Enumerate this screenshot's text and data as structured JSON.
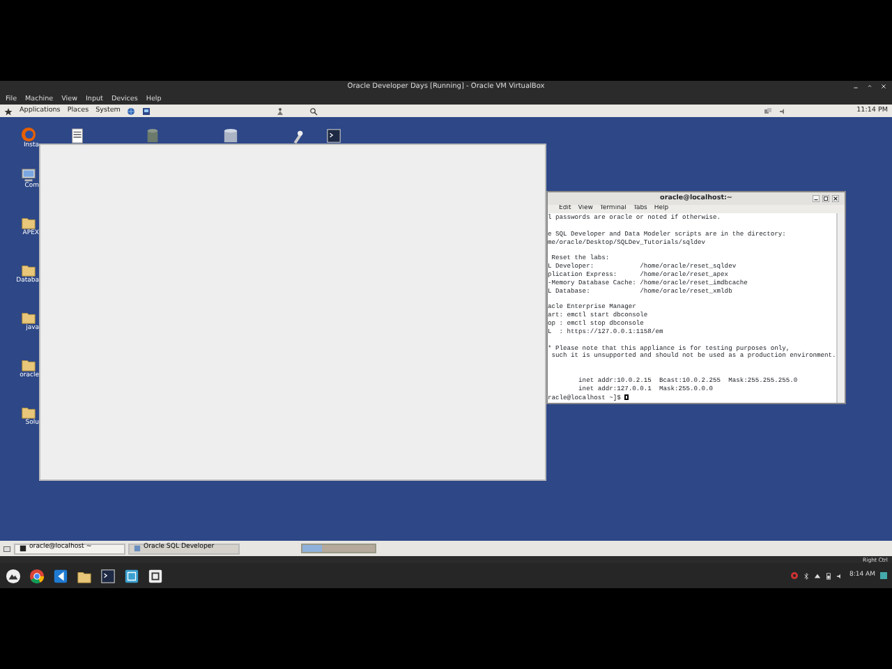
{
  "host_window": {
    "title": "Oracle Developer Days [Running] - Oracle VM VirtualBox"
  },
  "vbox_menu": [
    "File",
    "Machine",
    "View",
    "Input",
    "Devices",
    "Help"
  ],
  "guest_panel": {
    "menus": [
      "Applications",
      "Places",
      "System"
    ],
    "clock": "11:14 PM"
  },
  "desktop_top_icons": [
    {
      "kind": "document"
    },
    {
      "kind": "database-grey"
    },
    {
      "kind": "database-blue"
    },
    {
      "kind": "tool"
    },
    {
      "kind": "terminal"
    }
  ],
  "desktop_icons": [
    {
      "kind": "firefox",
      "label": "Insta"
    },
    {
      "kind": "computer",
      "label": "Com"
    },
    {
      "kind": "folder",
      "label": "APEX"
    },
    {
      "kind": "folder",
      "label": "Databa"
    },
    {
      "kind": "folder",
      "label": "java"
    },
    {
      "kind": "folder",
      "label": "oracle"
    },
    {
      "kind": "folder",
      "label": "Solu"
    }
  ],
  "terminal": {
    "title": "oracle@localhost:~",
    "menu": [
      "Edit",
      "View",
      "Terminal",
      "Tabs",
      "Help"
    ],
    "lines": [
      {
        "text": "l passwords are oracle or noted if otherwise."
      },
      {
        "kind": "blank"
      },
      {
        "text": "e SQL Developer and Data Modeler scripts are in the directory:"
      },
      {
        "text": "me/oracle/Desktop/SQLDev_Tutorials/sqldev"
      },
      {
        "kind": "blank"
      },
      {
        "text": " Reset the labs:"
      },
      {
        "text": "L Developer:            /home/oracle/reset_sqldev"
      },
      {
        "text": "plication Express:      /home/oracle/reset_apex"
      },
      {
        "text": "-Memory Database Cache: /home/oracle/reset_imdbcache"
      },
      {
        "text": "L Database:             /home/oracle/reset_xmldb"
      },
      {
        "kind": "blank"
      },
      {
        "text": "acle Enterprise Manager"
      },
      {
        "text": "art: emctl start dbconsole"
      },
      {
        "text": "op : emctl stop dbconsole"
      },
      {
        "text": "L  : https://127.0.0.1:1158/em"
      },
      {
        "kind": "blank"
      },
      {
        "text": "* Please note that this appliance is for testing purposes only,"
      },
      {
        "text": " such it is unsupported and should not be used as a production environment."
      },
      {
        "kind": "blank"
      },
      {
        "kind": "blank"
      },
      {
        "text": "        inet addr:10.0.2.15  Bcast:10.0.2.255  Mask:255.255.255.0"
      },
      {
        "text": "        inet addr:127.0.0.1  Mask:255.0.0.0"
      },
      {
        "text": "racle@localhost ~]$ "
      }
    ]
  },
  "guest_taskbar": [
    {
      "label": "oracle@localhost ~",
      "selected": false
    },
    {
      "label": "Oracle SQL Developer",
      "selected": true
    }
  ],
  "vbox_status": {
    "host_key": "Right Ctrl"
  },
  "host_taskbar": {
    "apps": [
      {
        "kind": "launcher"
      },
      {
        "kind": "chrome"
      },
      {
        "kind": "vscode"
      },
      {
        "kind": "folder"
      },
      {
        "kind": "terminal"
      },
      {
        "kind": "virtualbox"
      },
      {
        "kind": "window"
      }
    ],
    "clock": "8:14 AM"
  }
}
